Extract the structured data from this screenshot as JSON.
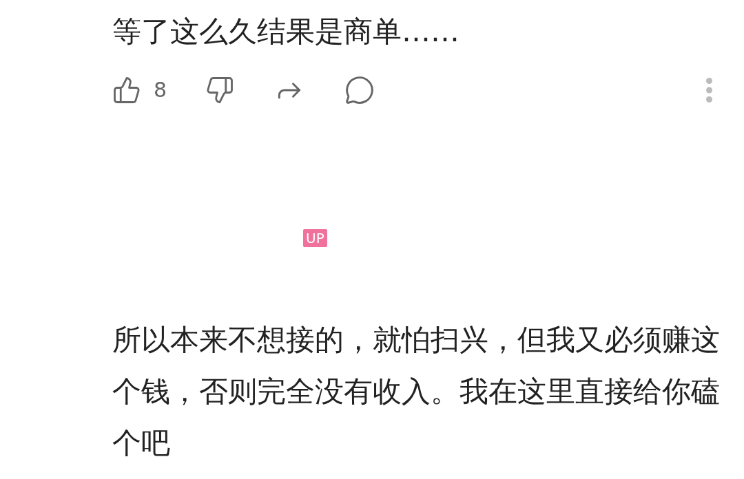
{
  "comment": {
    "text": "等了这么久结果是商单……",
    "like_count": "8"
  },
  "reply": {
    "badge": "UP",
    "text": "所以本来不想接的，就怕扫兴，但我又必须赚这个钱，否则完全没有收入。我在这里直接给你磕个吧"
  }
}
